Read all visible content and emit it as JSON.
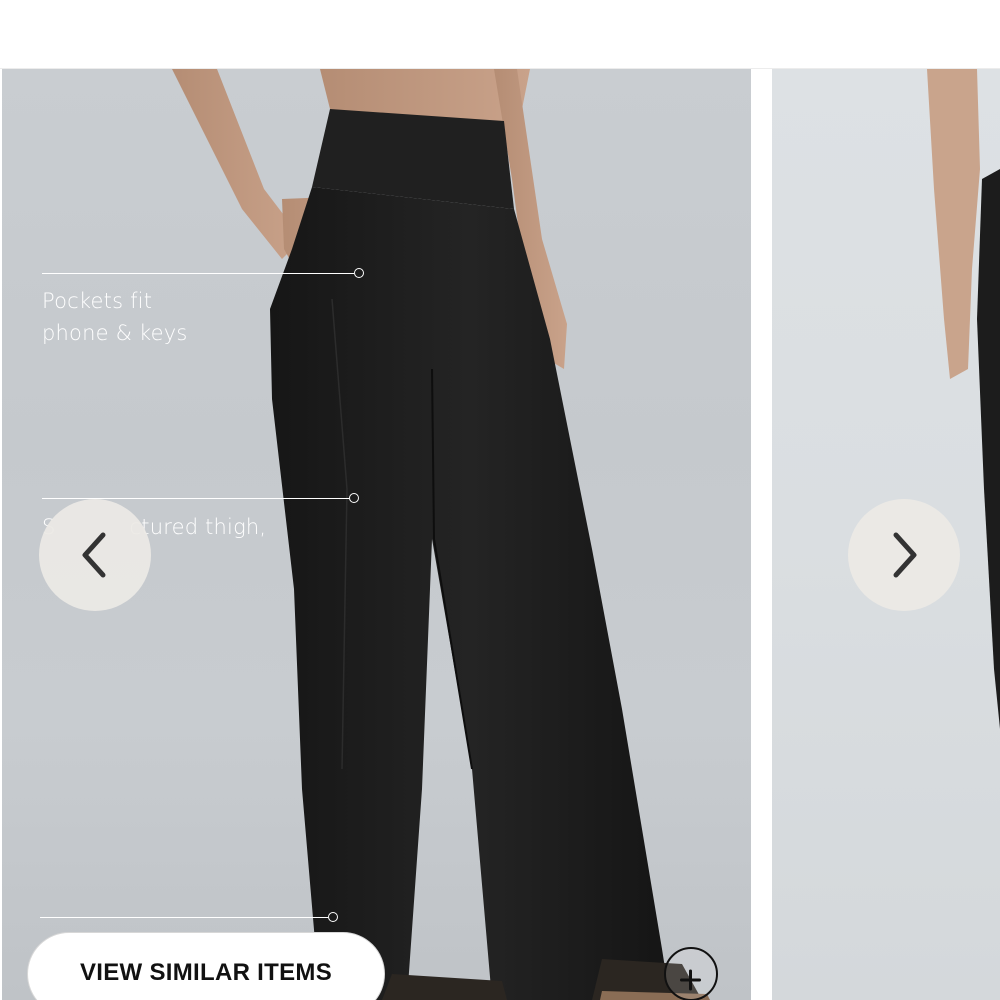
{
  "gallery": {
    "callouts": [
      {
        "text_line1": "Pockets fit",
        "text_line2": "phone & keys"
      },
      {
        "text_line1": "S",
        "text_line2": "ctured thigh,"
      },
      {
        "text_line1": "",
        "text_line2": ""
      }
    ],
    "prev_label": "Previous image",
    "next_label": "Next image",
    "zoom_label": "Zoom image"
  },
  "actions": {
    "view_similar_label": "VIEW SIMILAR ITEMS"
  },
  "colors": {
    "background": "#ffffff",
    "slide_background": "#c7cbcf",
    "pants": "#1d1d1d",
    "nav_button": "#ecebe6",
    "text_on_image": "#ffffff",
    "button_text": "#111111"
  },
  "icons": {
    "prev": "chevron-left-icon",
    "next": "chevron-right-icon",
    "zoom": "zoom-plus-icon"
  }
}
